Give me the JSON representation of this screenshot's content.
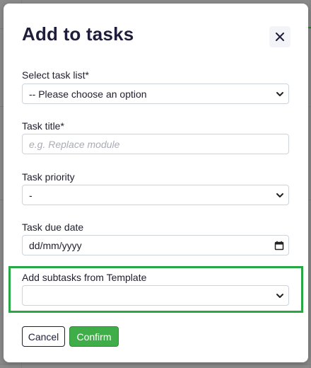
{
  "modal": {
    "title": "Add to tasks",
    "close_icon": "close-icon"
  },
  "form": {
    "task_list": {
      "label": "Select task list*",
      "value": "-- Please choose an option"
    },
    "task_title": {
      "label": "Task title*",
      "placeholder": "e.g. Replace module",
      "value": ""
    },
    "task_priority": {
      "label": "Task priority",
      "value": "-"
    },
    "task_due_date": {
      "label": "Task due date",
      "value": "dd/mm/yyyy",
      "icon": "calendar-icon"
    },
    "subtasks_template": {
      "label": "Add subtasks from Template",
      "value": ""
    }
  },
  "actions": {
    "cancel_label": "Cancel",
    "confirm_label": "Confirm"
  },
  "colors": {
    "highlight": "#27a844",
    "confirm_bg": "#3fae49",
    "title_text": "#1e1e3c",
    "backdrop": "#8a8a8a"
  }
}
